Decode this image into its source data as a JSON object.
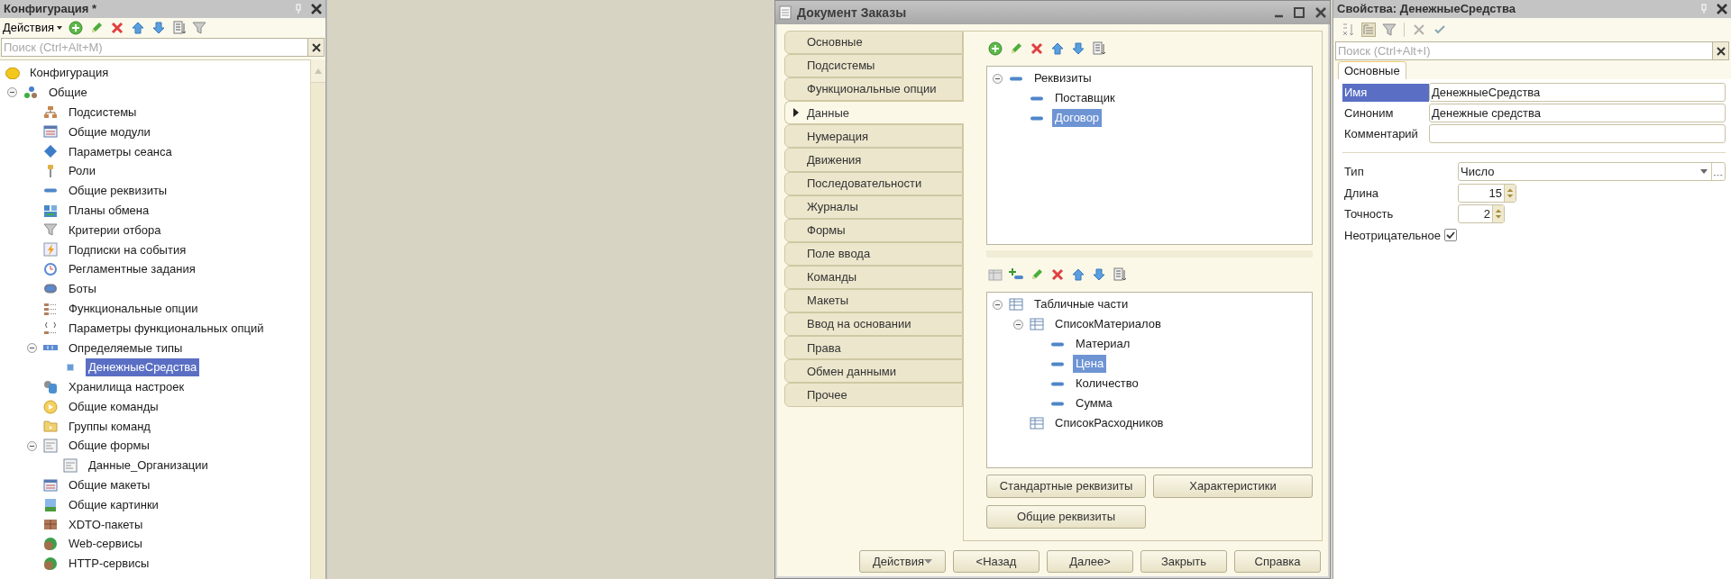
{
  "config_panel": {
    "title": "Конфигурация *",
    "actions_menu": "Действия",
    "search": {
      "placeholder": "Поиск (Ctrl+Alt+M)"
    },
    "tree": {
      "root": {
        "label": "Конфигурация"
      },
      "items": [
        {
          "label": "Общие",
          "selected": false,
          "expanded": true,
          "children": [
            {
              "label": "Подсистемы",
              "selected": false
            },
            {
              "label": "Общие модули",
              "selected": false
            },
            {
              "label": "Параметры сеанса",
              "selected": false
            },
            {
              "label": "Роли",
              "selected": false
            },
            {
              "label": "Общие реквизиты",
              "selected": false
            },
            {
              "label": "Планы обмена",
              "selected": false
            },
            {
              "label": "Критерии отбора",
              "selected": false
            },
            {
              "label": "Подписки на события",
              "selected": false
            },
            {
              "label": "Регламентные задания",
              "selected": false
            },
            {
              "label": "Боты",
              "selected": false
            },
            {
              "label": "Функциональные опции",
              "selected": false
            },
            {
              "label": "Параметры функциональных опций",
              "selected": false
            },
            {
              "label": "Определяемые типы",
              "selected": false,
              "expanded": true,
              "children": [
                {
                  "label": "ДенежныеСредства",
                  "selected": true
                }
              ]
            },
            {
              "label": "Хранилища настроек",
              "selected": false
            },
            {
              "label": "Общие команды",
              "selected": false
            },
            {
              "label": "Группы команд",
              "selected": false
            },
            {
              "label": "Общие формы",
              "selected": false,
              "expanded": true,
              "children": [
                {
                  "label": "Данные_Организации",
                  "selected": false
                }
              ]
            },
            {
              "label": "Общие макеты",
              "selected": false
            },
            {
              "label": "Общие картинки",
              "selected": false
            },
            {
              "label": "XDTO-пакеты",
              "selected": false
            },
            {
              "label": "Web-сервисы",
              "selected": false
            },
            {
              "label": "HTTP-сервисы",
              "selected": false
            }
          ]
        }
      ]
    }
  },
  "document_window": {
    "title": "Документ Заказы",
    "tabs": [
      {
        "label": "Основные",
        "selected": false
      },
      {
        "label": "Подсистемы",
        "selected": false
      },
      {
        "label": "Функциональные опции",
        "selected": false
      },
      {
        "label": "Данные",
        "selected": true
      },
      {
        "label": "Нумерация",
        "selected": false
      },
      {
        "label": "Движения",
        "selected": false
      },
      {
        "label": "Последовательности",
        "selected": false
      },
      {
        "label": "Журналы",
        "selected": false
      },
      {
        "label": "Формы",
        "selected": false
      },
      {
        "label": "Поле ввода",
        "selected": false
      },
      {
        "label": "Команды",
        "selected": false
      },
      {
        "label": "Макеты",
        "selected": false
      },
      {
        "label": "Ввод на основании",
        "selected": false
      },
      {
        "label": "Права",
        "selected": false
      },
      {
        "label": "Обмен данными",
        "selected": false
      },
      {
        "label": "Прочее",
        "selected": false
      }
    ],
    "attributes_tree": [
      {
        "label": "Реквизиты",
        "selected": false,
        "expanded": true,
        "children": [
          {
            "label": "Поставщик",
            "selected": false
          },
          {
            "label": "Договор",
            "selected": true
          }
        ]
      }
    ],
    "tabular_tree": [
      {
        "label": "Табличные части",
        "selected": false,
        "expanded": true,
        "children": [
          {
            "label": "СписокМатериалов",
            "selected": false,
            "expanded": true,
            "children": [
              {
                "label": "Материал",
                "selected": false
              },
              {
                "label": "Цена",
                "selected": true
              },
              {
                "label": "Количество",
                "selected": false
              },
              {
                "label": "Сумма",
                "selected": false
              }
            ]
          },
          {
            "label": "СписокРасходников",
            "selected": false
          }
        ]
      }
    ],
    "panel_buttons": [
      "Стандартные реквизиты",
      "Характеристики",
      "Общие реквизиты"
    ],
    "footer_buttons": [
      {
        "label": "Действия",
        "kind": "menu"
      },
      {
        "label": "<Назад",
        "kind": "plain"
      },
      {
        "label": "Далее>",
        "kind": "plain"
      },
      {
        "label": "Закрыть",
        "kind": "plain"
      },
      {
        "label": "Справка",
        "kind": "plain"
      }
    ]
  },
  "properties_panel": {
    "title": "Свойства: ДенежныеСредства",
    "search": {
      "placeholder": "Поиск (Ctrl+Alt+I)"
    },
    "tab": "Основные",
    "main_rows": [
      {
        "label": "Имя",
        "value": "ДенежныеСредства",
        "selected": true
      },
      {
        "label": "Синоним",
        "value": "Денежные средства",
        "selected": false
      },
      {
        "label": "Комментарий",
        "selected": false
      }
    ],
    "type_rows": [
      {
        "kind": "combo",
        "label": "Тип",
        "value": "Число"
      },
      {
        "kind": "number",
        "label": "Длина",
        "value": "15"
      },
      {
        "kind": "number",
        "label": "Точность",
        "value": "2"
      },
      {
        "kind": "checkbox",
        "label": "Неотрицательное",
        "checked": true
      }
    ]
  }
}
